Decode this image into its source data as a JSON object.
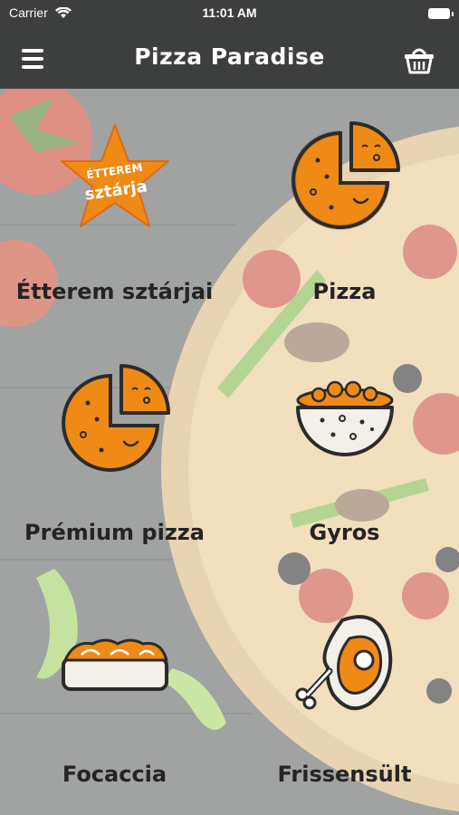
{
  "status_bar": {
    "carrier": "Carrier",
    "time": "11:01 AM"
  },
  "nav": {
    "title": "Pizza Paradise",
    "menu_icon": "hamburger-menu-icon",
    "cart_icon": "shopping-basket-icon"
  },
  "colors": {
    "bar": "#3c3f3d",
    "accent": "#ef8a17",
    "outline": "#2b2b2b"
  },
  "categories": [
    {
      "label": "Étterem sztárjai",
      "icon": "star-badge-icon",
      "badge_line1": "ÉTTEREM",
      "badge_line2": "sztárja"
    },
    {
      "label": "Pizza",
      "icon": "pizza-icon"
    },
    {
      "label": "Prémium pizza",
      "icon": "premium-pizza-icon"
    },
    {
      "label": "Gyros",
      "icon": "gyros-bowl-icon"
    },
    {
      "label": "Focaccia",
      "icon": "focaccia-icon"
    },
    {
      "label": "Frissensült",
      "icon": "meat-steak-icon"
    }
  ]
}
